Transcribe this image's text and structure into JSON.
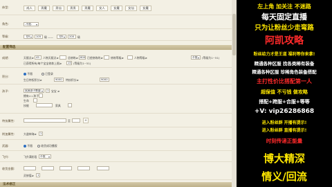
{
  "body_type": {
    "label": "体型:",
    "options": [
      "成人",
      "男魔",
      "男仙",
      "男男",
      "男魔",
      "女人",
      "女魔",
      "女仙",
      "女魔"
    ]
  },
  "role": {
    "label": "角色:",
    "value": "-不限-"
  },
  "level": {
    "label": "等级:",
    "from_sel": "飞升",
    "from_val": "105",
    "sep": "级 ——",
    "to_sel": "飞升",
    "to_val": "200",
    "unit": "级"
  },
  "section_config": "配置筛选",
  "attrs": {
    "label": "成就:",
    "line1": [
      "天赋点≥",
      "45",
      "人物天赋点≥",
      "总修练≥",
      "800",
      "已经修炼的≥",
      "修炼等级≥",
      "人物等级≥",
      "不限"
    ],
    "line1_tail": "(等级为1~51)",
    "line2": "已获得所有/每个宝宝修炼上限≥",
    "line2_val": "15",
    "line2_tail": "(等级为1~51)"
  },
  "points": {
    "label": "积分:",
    "radio1": "不限",
    "radio2": "已登录",
    "line2": "生日特权积分≥",
    "line2_val": "9000",
    "line2_b": "特技积分≥",
    "line2_bval": "9000"
  },
  "pet": {
    "label": "孩子:",
    "sel": "家具孩子数量",
    "sub": [
      "宝宝 ≥",
      "拥有>=孩子",
      "生命",
      "健康",
      "攻击",
      "体力",
      "技能",
      "家具"
    ],
    "val": "1"
  },
  "special": {
    "label": "特技属性:",
    "value": "",
    "mid": "至"
  },
  "stats": {
    "label": "附加属性:",
    "text": "大道神海≥",
    "val": "1"
  },
  "weapon": {
    "label": "武器:",
    "radio1": "不限",
    "radio2": "修炼+1",
    "chk": "收货成功播报"
  },
  "fly": {
    "label": "飞升:",
    "text": "飞升满阶段",
    "sel": "不限"
  },
  "collect": {
    "label": "收货金额:",
    "text": "灵修值≥",
    "val": "1"
  },
  "section_fabao": "法术修正",
  "ad": {
    "top": "左上角 加关注 不迷路",
    "l1": "每天固定直播",
    "l2": "只为让粉丝少走弯路",
    "l3": "阿凯攻略",
    "l4": "粉丝给力才是王道 福利等你来拿!",
    "l5": "精通各种区服 找各类稀有装备",
    "l6": "精通各种区服 珍稀角色装备搭配",
    "l7": "主打性价比搭配第一人",
    "l8": "超保值 不亏钱 做攻略",
    "l9": "搭配+跨服+合服+等等",
    "l10": "+V: vip26286868",
    "l11": "进入粉丝群 开播有提示!",
    "l12": "进入粉丝群 直播有提示!",
    "l13": "时刻传递正能量",
    "l14": "博大精深",
    "l15": "情义/回流",
    "colors": {
      "yellow": "#ffe800",
      "white": "#ffffff",
      "red": "#ff2a2a",
      "cyan": "#29d6ff",
      "bg": "#000000"
    }
  }
}
